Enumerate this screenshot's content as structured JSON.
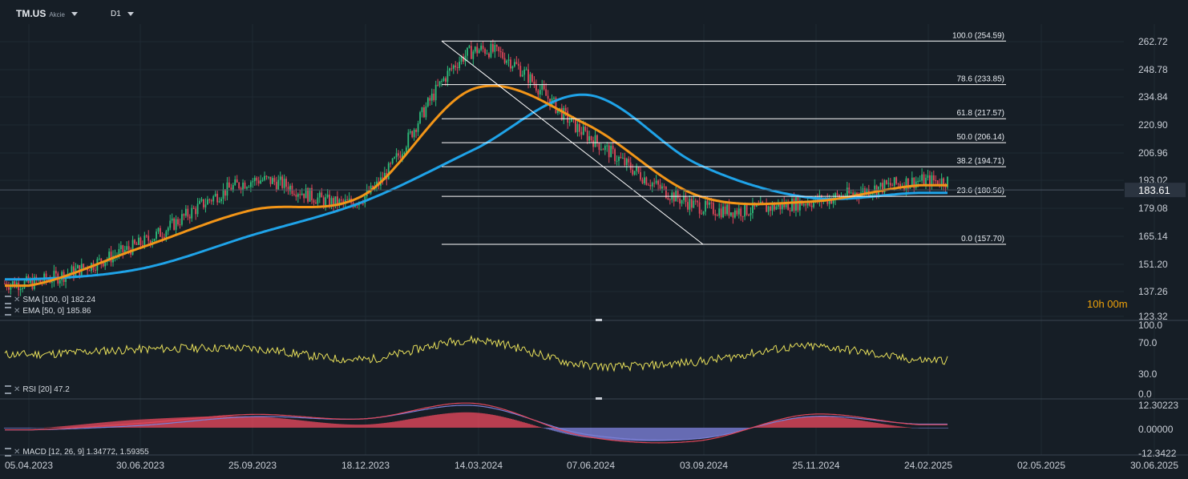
{
  "header": {
    "symbol": "TM.US",
    "market": "Akcie",
    "timeframe": "D1"
  },
  "timer": "10h 00m",
  "colors": {
    "background": "#161e26",
    "grid": "#1f2933",
    "up": "#2dbd7a",
    "down": "#e0475a",
    "sma": "#1fa3e8",
    "ema": "#f29518",
    "rsi": "#e8e05a",
    "macd_line": "#e0475a",
    "signal_line": "#7b7fd6",
    "hist_pos": "#e0475a",
    "hist_neg": "#7b7fd6",
    "price_tag": "#2b3440",
    "fib": "#ffffff",
    "timer": "#f0a30a"
  },
  "indicators": {
    "sma_label": "SMA [100, 0] 182.24",
    "ema_label": "EMA [50, 0] 185.86",
    "rsi_label": "RSI [20] 47.2",
    "macd_label": "MACD [12, 26, 9] 1.34772, 1.59355"
  },
  "chart_data": [
    {
      "type": "candlestick",
      "title": "TM.US",
      "x": [
        "05.04.2023",
        "30.06.2023",
        "25.09.2023",
        "18.12.2023",
        "14.03.2024",
        "07.06.2024",
        "03.09.2024",
        "25.11.2024",
        "24.02.2025",
        "02.05.2025",
        "30.06.2025"
      ],
      "x_tick_labels": [
        "05.04.2023",
        "30.06.2023",
        "25.09.2023",
        "18.12.2023",
        "14.03.2024",
        "07.06.2024",
        "03.09.2024",
        "25.11.2024",
        "24.02.2025",
        "02.05.2025",
        "30.06.2025"
      ],
      "y_tick_labels": [
        "262.72",
        "248.78",
        "234.84",
        "220.90",
        "206.96",
        "193.02",
        "179.08",
        "165.14",
        "151.20",
        "137.26",
        "123.32"
      ],
      "ylim": [
        123.32,
        262.72
      ],
      "last_price": "183.61",
      "close_series": {
        "x": [
          "05.04.2023",
          "30.06.2023",
          "25.09.2023",
          "18.12.2023",
          "14.03.2024",
          "07.06.2024",
          "03.09.2024",
          "25.11.2024",
          "24.02.2025"
        ],
        "values": [
          139,
          158,
          188,
          180,
          250,
          210,
          176,
          178,
          188
        ]
      },
      "series": [
        {
          "name": "SMA [100, 0]",
          "x": [
            "05.04.2023",
            "30.06.2023",
            "25.09.2023",
            "18.12.2023",
            "14.03.2024",
            "07.06.2024",
            "03.09.2024",
            "25.11.2024",
            "24.02.2025"
          ],
          "values": [
            141,
            146,
            162,
            178,
            203,
            229,
            196,
            180,
            182.24
          ]
        },
        {
          "name": "EMA [50, 0]",
          "x": [
            "05.04.2023",
            "30.06.2023",
            "25.09.2023",
            "18.12.2023",
            "14.03.2024",
            "07.06.2024",
            "03.09.2024",
            "25.11.2024",
            "24.02.2025"
          ],
          "values": [
            138,
            156,
            174,
            181,
            232,
            215,
            181,
            178,
            185.86
          ]
        }
      ],
      "fibonacci": [
        {
          "label": "100.0 (254.59)",
          "value": 254.59
        },
        {
          "label": "78.6 (233.85)",
          "value": 233.85
        },
        {
          "label": "61.8 (217.57)",
          "value": 217.57
        },
        {
          "label": "50.0 (206.14)",
          "value": 206.14
        },
        {
          "label": "38.2 (194.71)",
          "value": 194.71
        },
        {
          "label": "23.6 (180.56)",
          "value": 180.56
        },
        {
          "label": "0.0 (157.70)",
          "value": 157.7
        }
      ]
    },
    {
      "type": "line",
      "title": "RSI [20]",
      "y_tick_labels": [
        "100.0",
        "70.0",
        "30.0",
        "0.0"
      ],
      "ylim": [
        0,
        100
      ],
      "x": [
        "05.04.2023",
        "30.06.2023",
        "25.09.2023",
        "18.12.2023",
        "14.03.2024",
        "07.06.2024",
        "03.09.2024",
        "25.11.2024",
        "24.02.2025"
      ],
      "values": [
        55,
        62,
        63,
        48,
        75,
        40,
        45,
        66,
        47.2
      ]
    },
    {
      "type": "bar",
      "title": "MACD [12, 26, 9]",
      "y_tick_labels": [
        "12.30223",
        "0.00000",
        "-12.3422"
      ],
      "ylim": [
        -12.3422,
        12.30223
      ],
      "x": [
        "05.04.2023",
        "30.06.2023",
        "25.09.2023",
        "18.12.2023",
        "14.03.2024",
        "07.06.2024",
        "03.09.2024",
        "25.11.2024",
        "24.02.2025"
      ],
      "macd": [
        -1,
        2,
        6,
        4,
        11,
        -4,
        -6,
        6,
        1.34772
      ],
      "signal": [
        -1,
        1,
        5,
        4,
        10,
        -3,
        -5,
        5,
        1.59355
      ]
    }
  ]
}
